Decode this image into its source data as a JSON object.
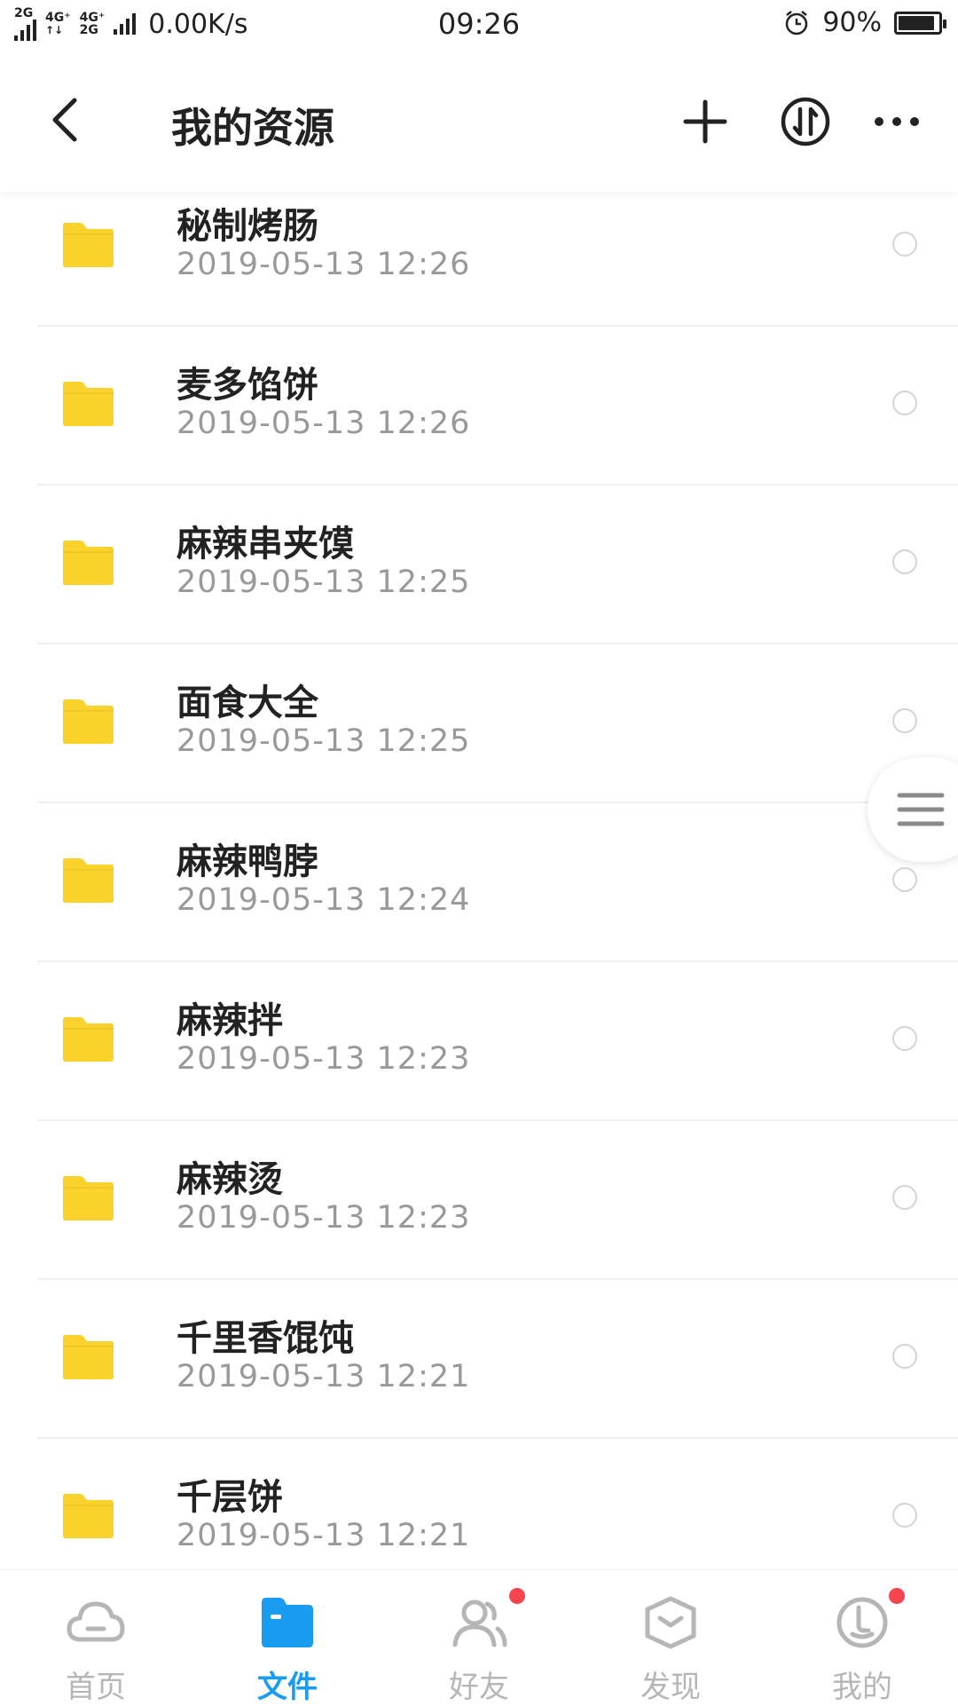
{
  "status_bar": {
    "net_tag_1": "2G",
    "net_tag_2": "4G⁺",
    "net_tag_3": "4G⁺",
    "net_tag_4": "2G",
    "net_speed": "0.00K/s",
    "time": "09:26",
    "battery": "90%",
    "battery_level": 0.9
  },
  "header": {
    "title": "我的资源",
    "icons": [
      "back-arrow-icon",
      "plus-icon",
      "transfer-icon",
      "more-icon"
    ]
  },
  "files": [
    {
      "name": "秘制烤肠",
      "date": "2019-05-13  12:26"
    },
    {
      "name": "麦多馅饼",
      "date": "2019-05-13  12:26"
    },
    {
      "name": "麻辣串夹馍",
      "date": "2019-05-13  12:25"
    },
    {
      "name": "面食大全",
      "date": "2019-05-13  12:25"
    },
    {
      "name": "麻辣鸭脖",
      "date": "2019-05-13  12:24"
    },
    {
      "name": "麻辣拌",
      "date": "2019-05-13  12:23"
    },
    {
      "name": "麻辣烫",
      "date": "2019-05-13  12:23"
    },
    {
      "name": "千里香馄饨",
      "date": "2019-05-13  12:21"
    },
    {
      "name": "千层饼",
      "date": "2019-05-13  12:21"
    }
  ],
  "bottom_nav": [
    {
      "label": "首页",
      "icon": "cloud-icon",
      "active": false
    },
    {
      "label": "文件",
      "icon": "folder-icon",
      "active": true
    },
    {
      "label": "好友",
      "icon": "friends-icon",
      "active": false,
      "badge": true
    },
    {
      "label": "发现",
      "icon": "discover-icon",
      "active": false
    },
    {
      "label": "我的",
      "icon": "profile-icon",
      "active": false,
      "badge": true
    }
  ],
  "colors": {
    "folder": "#FBD22B",
    "accent": "#1A9CF0",
    "badge": "#F5454F",
    "inactive": "#B6B6B6"
  }
}
